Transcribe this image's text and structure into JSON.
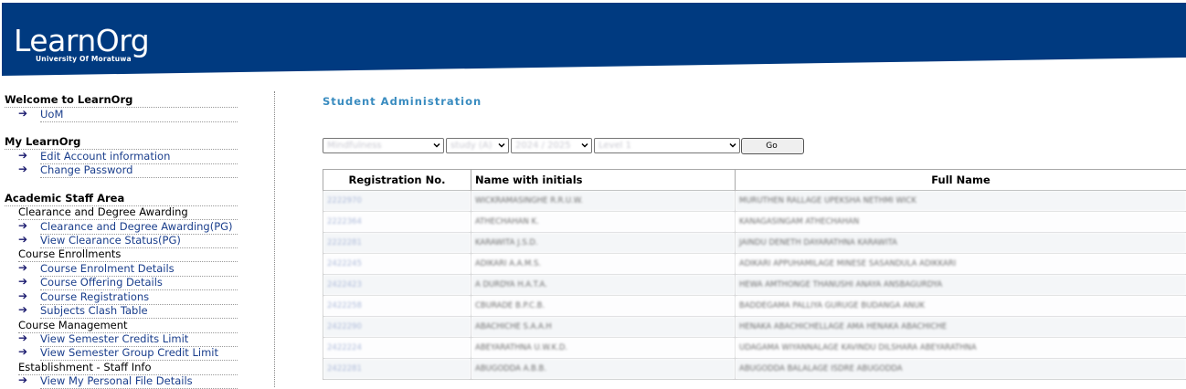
{
  "header": {
    "logo_title": "LearnOrg",
    "logo_subtitle": "University Of Moratuwa",
    "bg_color": "#003a80"
  },
  "sidebar": {
    "welcome": {
      "title": "Welcome to LearnOrg",
      "links": [
        "UoM"
      ]
    },
    "my_learnorg": {
      "title": "My LearnOrg",
      "links": [
        "Edit Account information",
        "Change Password"
      ]
    },
    "academic": {
      "title": "Academic Staff Area",
      "groups": [
        {
          "heading": "Clearance and Degree Awarding",
          "links": [
            "Clearance and Degree Awarding(PG)",
            "View Clearance Status(PG)"
          ]
        },
        {
          "heading": "Course Enrollments",
          "links": [
            "Course Enrolment Details",
            "Course Offering Details",
            "Course Registrations",
            "Subjects Clash Table"
          ]
        },
        {
          "heading": "Course Management",
          "links": [
            "View Semester Credits Limit",
            "View Semester Group Credit Limit"
          ]
        },
        {
          "heading": "Establishment - Staff Info",
          "links": [
            "View My Personal File Details"
          ]
        }
      ]
    },
    "arrow_icon": "right-arrow-icon"
  },
  "main": {
    "heading": "Student Administration",
    "filters": {
      "department": "Mindfulness",
      "stream": "study (A)",
      "year": "2024 / 2025",
      "level": "Level 1",
      "go_label": "Go"
    },
    "table": {
      "columns": [
        "Registration No.",
        "Name with initials",
        "Full Name"
      ],
      "rows": [
        [
          "2222970",
          "WICKRAMASINGHE R.R.U.W.",
          "MURUTHEN RALLAGE UPEKSHA NETHMI WICK"
        ],
        [
          "2222364",
          "ATHECHAHAN K.",
          "KANAGASINGAM ATHECHAHAN"
        ],
        [
          "2222281",
          "KARAWITA J.S.D.",
          "JAINDU DENETH DAYARATHNA KARAWITA"
        ],
        [
          "2422245",
          "ADIKARI A.A.M.S.",
          "ADIKARI APPUHAMILAGE MINESE SASANDULA ADIKKARI"
        ],
        [
          "2422423",
          "A DURDYA H.A.T.A.",
          "HEWA AMTHONGE THANUSHI ANAYA ANSBAGURDYA"
        ],
        [
          "2422258",
          "CBURADE B.P.C.B.",
          "BADDEGAMA PALLIYA GURUGE BUDANGA ANUK"
        ],
        [
          "2422290",
          "ABACHICHE S.A.A.H",
          "HENAKA ABACHICHELLAGE AMA HENAKA ABACHICHE"
        ],
        [
          "2422224",
          "ABEYARATHNA U.W.K.D.",
          "UDAGAMA WIYANNALAGE KAVINDU DILSHARA ABEYARATHNA"
        ],
        [
          "2422281",
          "ABUGODDA A.B.B.",
          "ABUGODDA BALALAGE ISDRE ABUGODDA"
        ]
      ]
    }
  }
}
